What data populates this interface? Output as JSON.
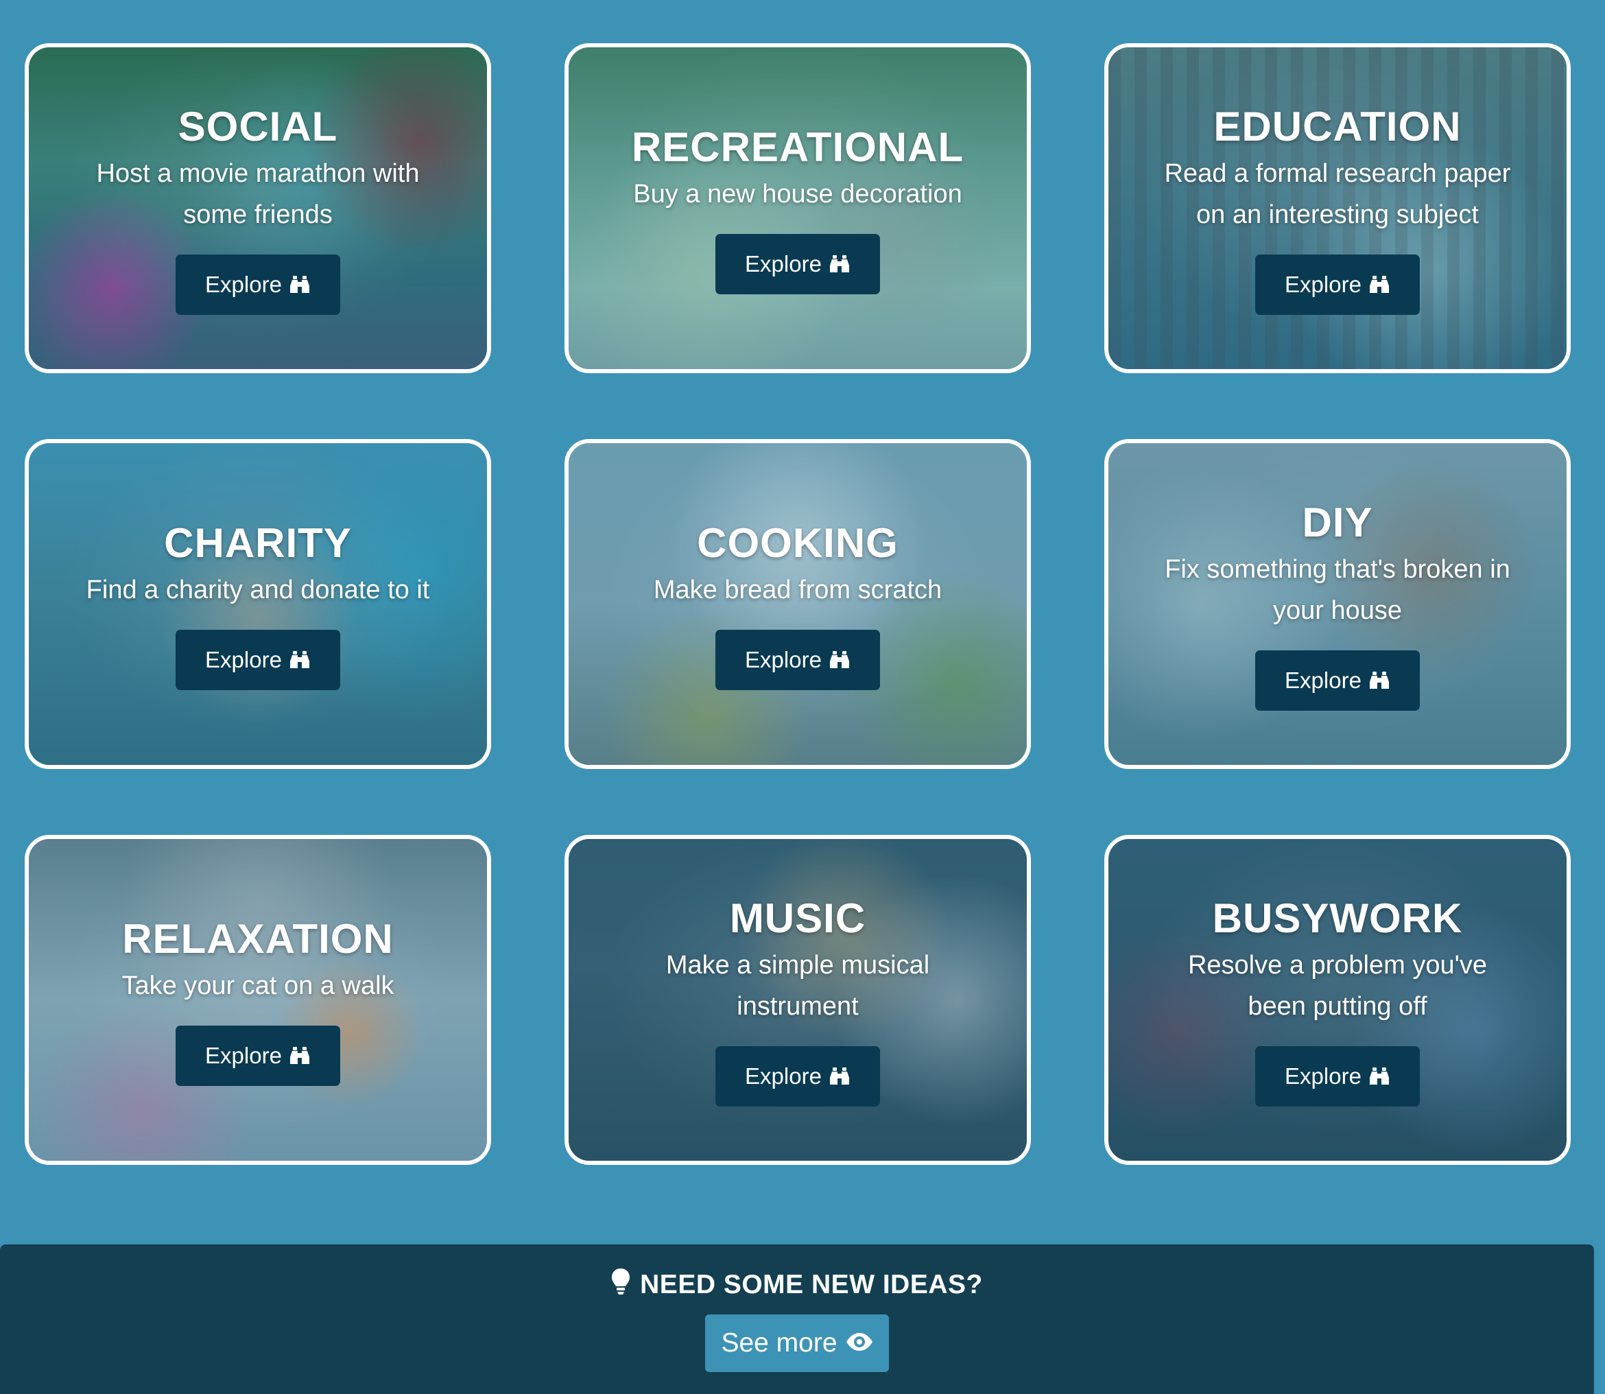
{
  "cards": [
    {
      "title": "SOCIAL",
      "description": "Host a movie marathon with some friends",
      "button_label": "Explore"
    },
    {
      "title": "RECREATIONAL",
      "description": "Buy a new house decoration",
      "button_label": "Explore"
    },
    {
      "title": "EDUCATION",
      "description": "Read a formal research paper on an interesting subject",
      "button_label": "Explore"
    },
    {
      "title": "CHARITY",
      "description": "Find a charity and donate to it",
      "button_label": "Explore"
    },
    {
      "title": "COOKING",
      "description": "Make bread from scratch",
      "button_label": "Explore"
    },
    {
      "title": "DIY",
      "description": "Fix something that's broken in your house",
      "button_label": "Explore"
    },
    {
      "title": "RELAXATION",
      "description": "Take your cat on a walk",
      "button_label": "Explore"
    },
    {
      "title": "MUSIC",
      "description": "Make a simple musical instrument",
      "button_label": "Explore"
    },
    {
      "title": "BUSYWORK",
      "description": "Resolve a problem you've been putting off",
      "button_label": "Explore"
    }
  ],
  "card_button_icon": "binoculars-icon",
  "footer": {
    "heading": "NEED SOME NEW IDEAS?",
    "heading_icon": "lightbulb-icon",
    "button_label": "See more",
    "button_icon": "eye-icon"
  },
  "colors": {
    "page_background": "#3d93b5",
    "card_border": "#ffffff",
    "explore_button": "#093a52",
    "footer_background": "#133f51",
    "see_more_button": "#3d93b5"
  }
}
